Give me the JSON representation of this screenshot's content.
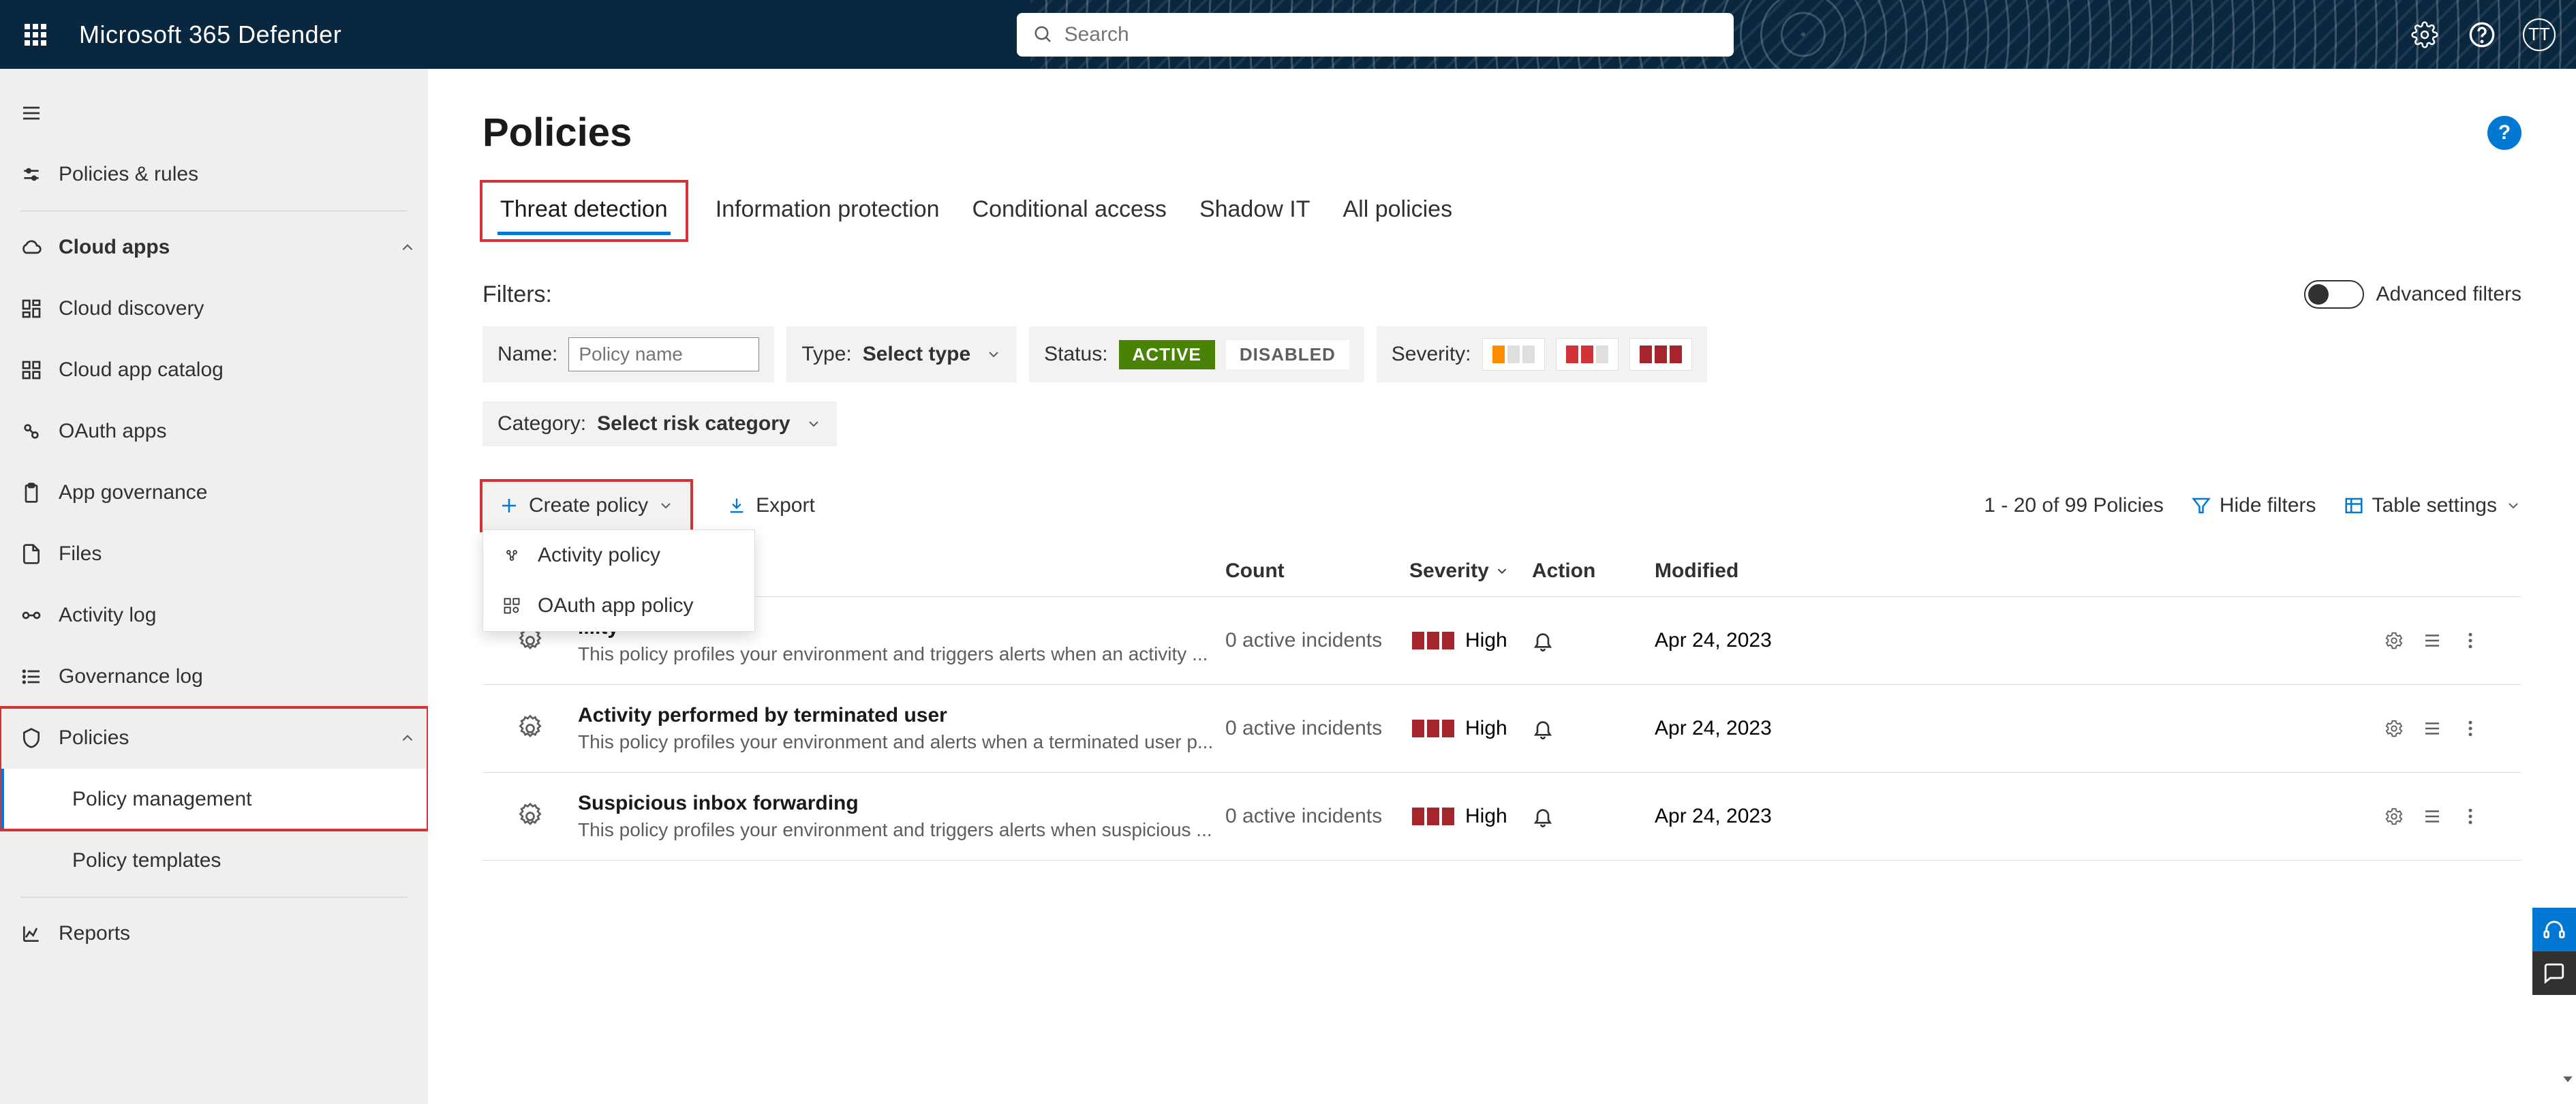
{
  "header": {
    "product_name": "Microsoft 365 Defender",
    "search_placeholder": "Search",
    "avatar_initials": "TT"
  },
  "sidebar": {
    "items": [
      {
        "id": "hamburger",
        "icon": "menu",
        "label": ""
      },
      {
        "id": "policies-rules",
        "icon": "sliders",
        "label": "Policies & rules"
      },
      {
        "id": "sep1",
        "sep": true
      },
      {
        "id": "cloud-apps",
        "icon": "cloud",
        "label": "Cloud apps",
        "bold": true,
        "chev": "up"
      },
      {
        "id": "cloud-discovery",
        "icon": "dashboard",
        "label": "Cloud discovery"
      },
      {
        "id": "cloud-app-catalog",
        "icon": "grid",
        "label": "Cloud app catalog"
      },
      {
        "id": "oauth-apps",
        "icon": "link",
        "label": "OAuth apps"
      },
      {
        "id": "app-governance",
        "icon": "clipboard",
        "label": "App governance"
      },
      {
        "id": "files",
        "icon": "file",
        "label": "Files"
      },
      {
        "id": "activity-log",
        "icon": "activity",
        "label": "Activity log"
      },
      {
        "id": "governance-log",
        "icon": "list",
        "label": "Governance log"
      },
      {
        "id": "policies",
        "icon": "shield",
        "label": "Policies",
        "chev": "up"
      },
      {
        "id": "policy-management",
        "indent": true,
        "label": "Policy management",
        "active": true
      },
      {
        "id": "policy-templates",
        "indent": true,
        "label": "Policy templates"
      },
      {
        "id": "sep2",
        "sep": true
      },
      {
        "id": "reports",
        "icon": "chart",
        "label": "Reports"
      }
    ]
  },
  "main": {
    "title": "Policies",
    "tabs": [
      {
        "id": "threat-detection",
        "label": "Threat detection",
        "active": true
      },
      {
        "id": "info-protection",
        "label": "Information protection"
      },
      {
        "id": "conditional-access",
        "label": "Conditional access"
      },
      {
        "id": "shadow-it",
        "label": "Shadow IT"
      },
      {
        "id": "all-policies",
        "label": "All policies"
      }
    ],
    "filters_label": "Filters:",
    "advanced_filters": "Advanced filters",
    "filter_name_label": "Name:",
    "filter_name_placeholder": "Policy name",
    "filter_type_label": "Type:",
    "filter_type_value": "Select type",
    "filter_status_label": "Status:",
    "status_active": "ACTIVE",
    "status_disabled": "DISABLED",
    "filter_severity_label": "Severity:",
    "filter_category_label": "Category:",
    "filter_category_value": "Select risk category",
    "toolbar": {
      "create_policy": "Create policy",
      "export": "Export",
      "count_text": "1 - 20 of 99 Policies",
      "hide_filters": "Hide filters",
      "table_settings": "Table settings",
      "dropdown": [
        {
          "id": "activity-policy",
          "label": "Activity policy"
        },
        {
          "id": "oauth-app-policy",
          "label": "OAuth app policy"
        }
      ]
    },
    "columns": {
      "count": "Count",
      "severity": "Severity",
      "action": "Action",
      "modified": "Modified"
    },
    "rows": [
      {
        "title": "...ity",
        "desc": "This policy profiles your environment and triggers alerts when an activity ...",
        "count": "0 active incidents",
        "severity": "High",
        "modified": "Apr 24, 2023"
      },
      {
        "title": "Activity performed by terminated user",
        "desc": "This policy profiles your environment and alerts when a terminated user p...",
        "count": "0 active incidents",
        "severity": "High",
        "modified": "Apr 24, 2023"
      },
      {
        "title": "Suspicious inbox forwarding",
        "desc": "This policy profiles your environment and triggers alerts when suspicious ...",
        "count": "0 active incidents",
        "severity": "High",
        "modified": "Apr 24, 2023"
      }
    ]
  }
}
